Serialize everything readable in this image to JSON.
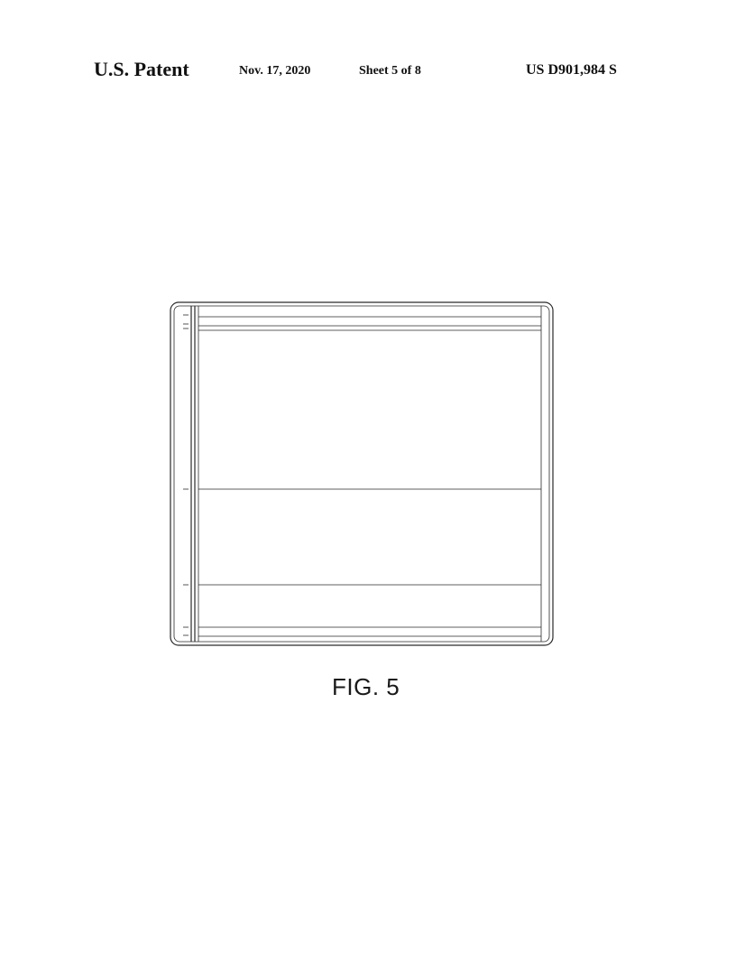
{
  "header": {
    "publication": "U.S. Patent",
    "date": "Nov. 17, 2020",
    "sheet": "Sheet 5 of 8",
    "patent_number": "US D901,984 S"
  },
  "figure": {
    "label": "FIG. 5"
  }
}
